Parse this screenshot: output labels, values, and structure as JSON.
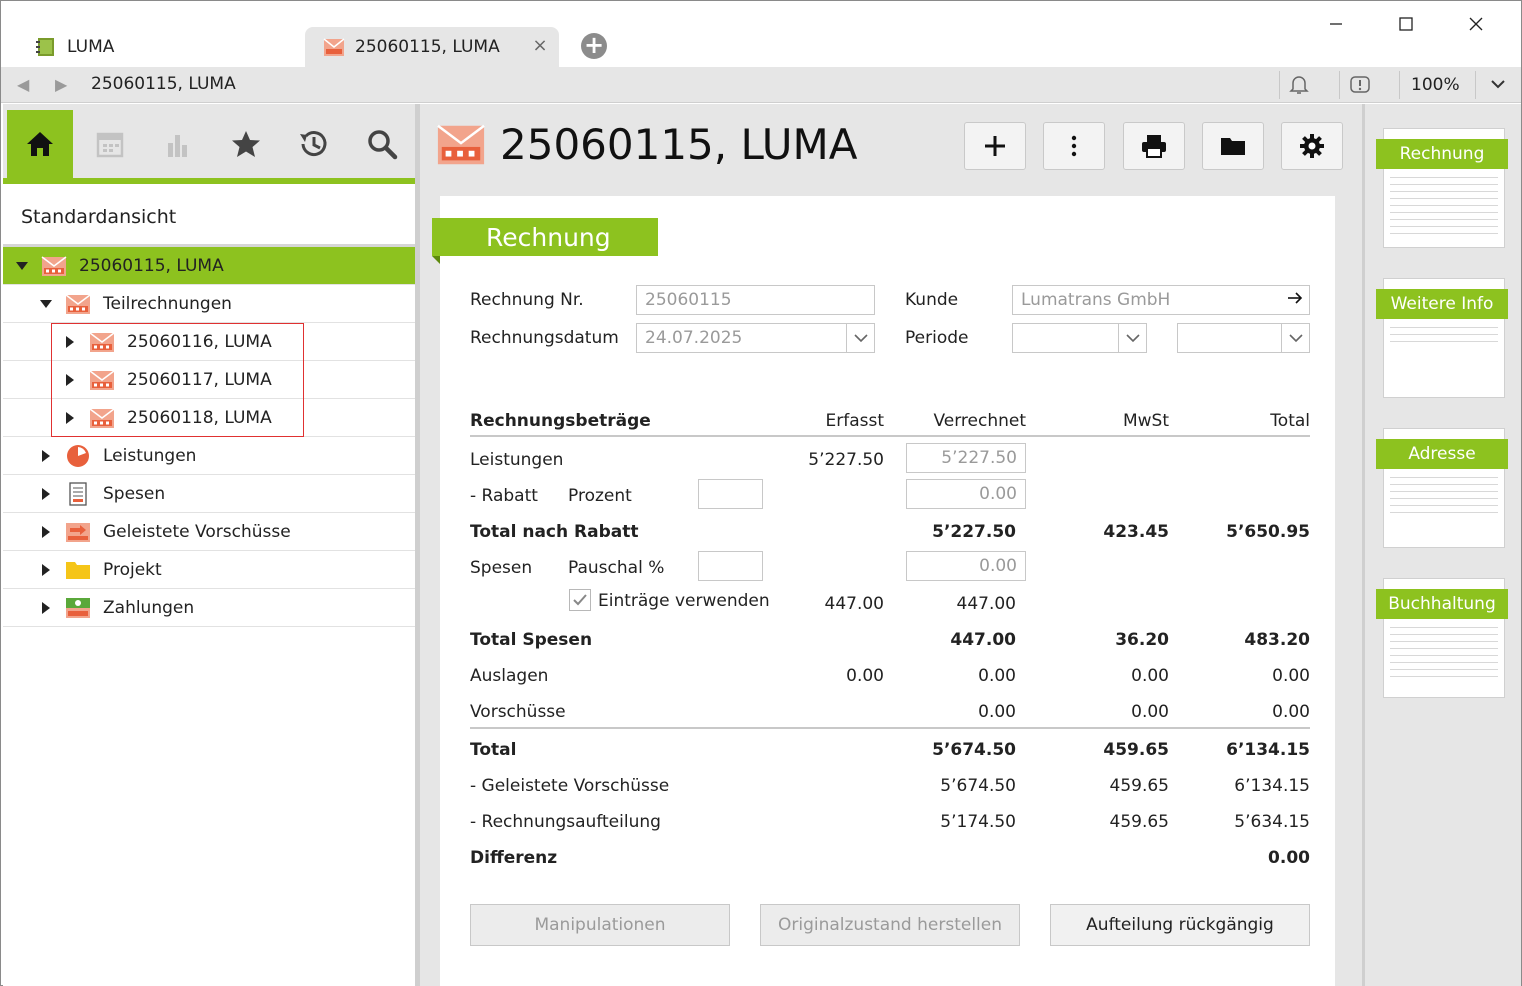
{
  "window": {
    "tabs": [
      {
        "label": "LUMA"
      },
      {
        "label": "25060115, LUMA"
      }
    ],
    "close_symbol": "×"
  },
  "address": {
    "path": "25060115, LUMA",
    "zoom": "100%"
  },
  "left": {
    "view_title": "Standardansicht",
    "tree": [
      {
        "label": "25060115, LUMA",
        "level": 0,
        "expanded": true,
        "icon": "invoice-icon"
      },
      {
        "label": "Teilrechnungen",
        "level": 1,
        "expanded": true,
        "icon": "invoice-icon"
      },
      {
        "label": "25060116, LUMA",
        "level": 2,
        "expanded": false,
        "icon": "invoice-icon"
      },
      {
        "label": "25060117, LUMA",
        "level": 2,
        "expanded": false,
        "icon": "invoice-icon"
      },
      {
        "label": "25060118, LUMA",
        "level": 2,
        "expanded": false,
        "icon": "invoice-icon"
      },
      {
        "label": "Leistungen",
        "level": 1,
        "expanded": false,
        "icon": "services-icon"
      },
      {
        "label": "Spesen",
        "level": 1,
        "expanded": false,
        "icon": "expenses-icon"
      },
      {
        "label": "Geleistete Vorschüsse",
        "level": 1,
        "expanded": false,
        "icon": "advance-icon"
      },
      {
        "label": "Projekt",
        "level": 1,
        "expanded": false,
        "icon": "folder-icon"
      },
      {
        "label": "Zahlungen",
        "level": 1,
        "expanded": false,
        "icon": "payments-icon"
      }
    ]
  },
  "main": {
    "title": "25060115, LUMA",
    "section": "Rechnung",
    "form": {
      "rechnung_nr_label": "Rechnung Nr.",
      "rechnung_nr": "25060115",
      "datum_label": "Rechnungsdatum",
      "datum": "24.07.2025",
      "kunde_label": "Kunde",
      "kunde": "Lumatrans GmbH",
      "periode_label": "Periode"
    },
    "amounts": {
      "header": {
        "title": "Rechnungsbeträge",
        "erfasst": "Erfasst",
        "verrechnet": "Verrechnet",
        "mwst": "MwSt",
        "total": "Total"
      },
      "leistungen": {
        "label": "Leistungen",
        "erfasst": "5’227.50",
        "verrechnet": "5’227.50"
      },
      "rabatt": {
        "label": "-  Rabatt",
        "sub_label": "Prozent",
        "verrechnet": "0.00"
      },
      "total_nach_rabatt": {
        "label": "Total nach Rabatt",
        "verrechnet": "5’227.50",
        "mwst": "423.45",
        "total": "5’650.95"
      },
      "spesen": {
        "label": "Spesen",
        "sub_label": "Pauschal %",
        "verrechnet": "0.00",
        "checkbox_label": "Einträge verwenden",
        "checked": true,
        "erfasst": "447.00",
        "verrechnet2": "447.00"
      },
      "total_spesen": {
        "label": "Total Spesen",
        "verrechnet": "447.00",
        "mwst": "36.20",
        "total": "483.20"
      },
      "auslagen": {
        "label": "Auslagen",
        "erfasst": "0.00",
        "verrechnet": "0.00",
        "mwst": "0.00",
        "total": "0.00"
      },
      "vorschuesse": {
        "label": "Vorschüsse",
        "verrechnet": "0.00",
        "mwst": "0.00",
        "total": "0.00"
      },
      "total": {
        "label": "Total",
        "verrechnet": "5’674.50",
        "mwst": "459.65",
        "total": "6’134.15"
      },
      "geleistete": {
        "label": "-  Geleistete Vorschüsse",
        "verrechnet": "5’674.50",
        "mwst": "459.65",
        "total": "6’134.15"
      },
      "aufteilung": {
        "label": "-  Rechnungsaufteilung",
        "verrechnet": "5’174.50",
        "mwst": "459.65",
        "total": "5’634.15"
      },
      "differenz": {
        "label": "Differenz",
        "total": "0.00"
      }
    },
    "buttons": {
      "manipulationen": "Manipulationen",
      "original": "Originalzustand herstellen",
      "aufteilung": "Aufteilung rückgängig"
    }
  },
  "right": {
    "thumbs": [
      {
        "label": "Rechnung"
      },
      {
        "label": "Weitere Info"
      },
      {
        "label": "Adresse"
      },
      {
        "label": "Buchhaltung"
      }
    ]
  },
  "colors": {
    "accent": "#8dc21f",
    "selection_border": "#e03131",
    "panel_bg": "#e6e6e6"
  }
}
